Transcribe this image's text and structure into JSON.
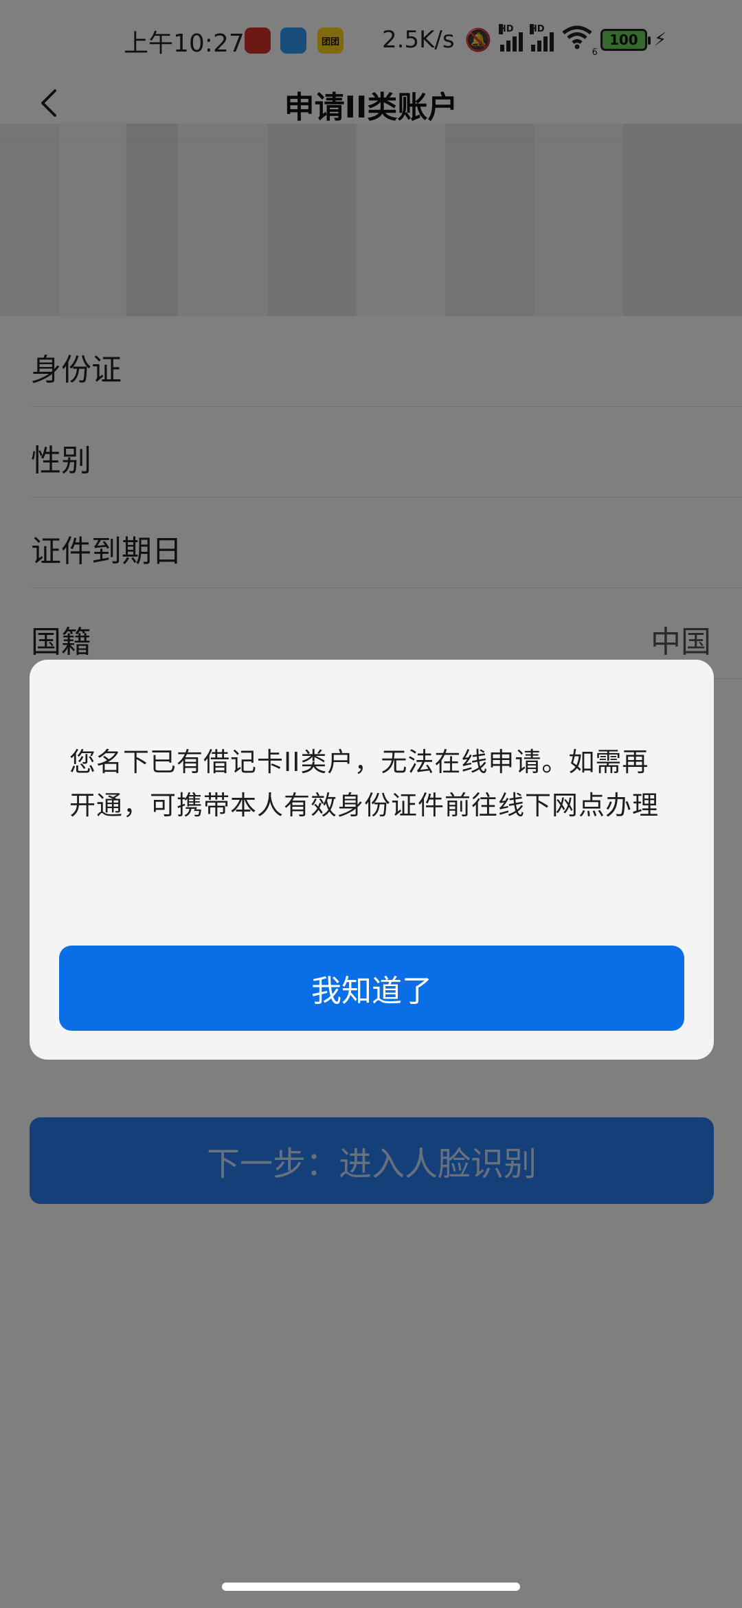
{
  "status_bar": {
    "time": "上午10:27",
    "network_speed": "2.5K/s",
    "signal_badge": "HD",
    "wifi_badge": "6",
    "battery": "100",
    "app_icons": [
      "news-app-icon",
      "cloud-app-icon",
      "meituan-app-icon"
    ],
    "app_icon_colors": [
      "#d8322b",
      "#2e9bf0",
      "#ffd41a"
    ],
    "app_icon_text_3": "团团"
  },
  "nav": {
    "title": "申请II类账户"
  },
  "form": {
    "rows": [
      {
        "label": "身份证",
        "value": ""
      },
      {
        "label": "性别",
        "value": ""
      },
      {
        "label": "证件到期日",
        "value": ""
      },
      {
        "label": "国籍",
        "value": "中国"
      }
    ]
  },
  "next_button": {
    "label": "下一步：进入人脸识别"
  },
  "dialog": {
    "message": "您名下已有借记卡II类户，无法在线申请。如需再开通，可携带本人有效身份证件前往线下网点办理",
    "confirm_label": "我知道了"
  },
  "colors": {
    "primary_blue": "#0a6fe6",
    "scrim": "rgba(0,0,0,0.5)"
  }
}
